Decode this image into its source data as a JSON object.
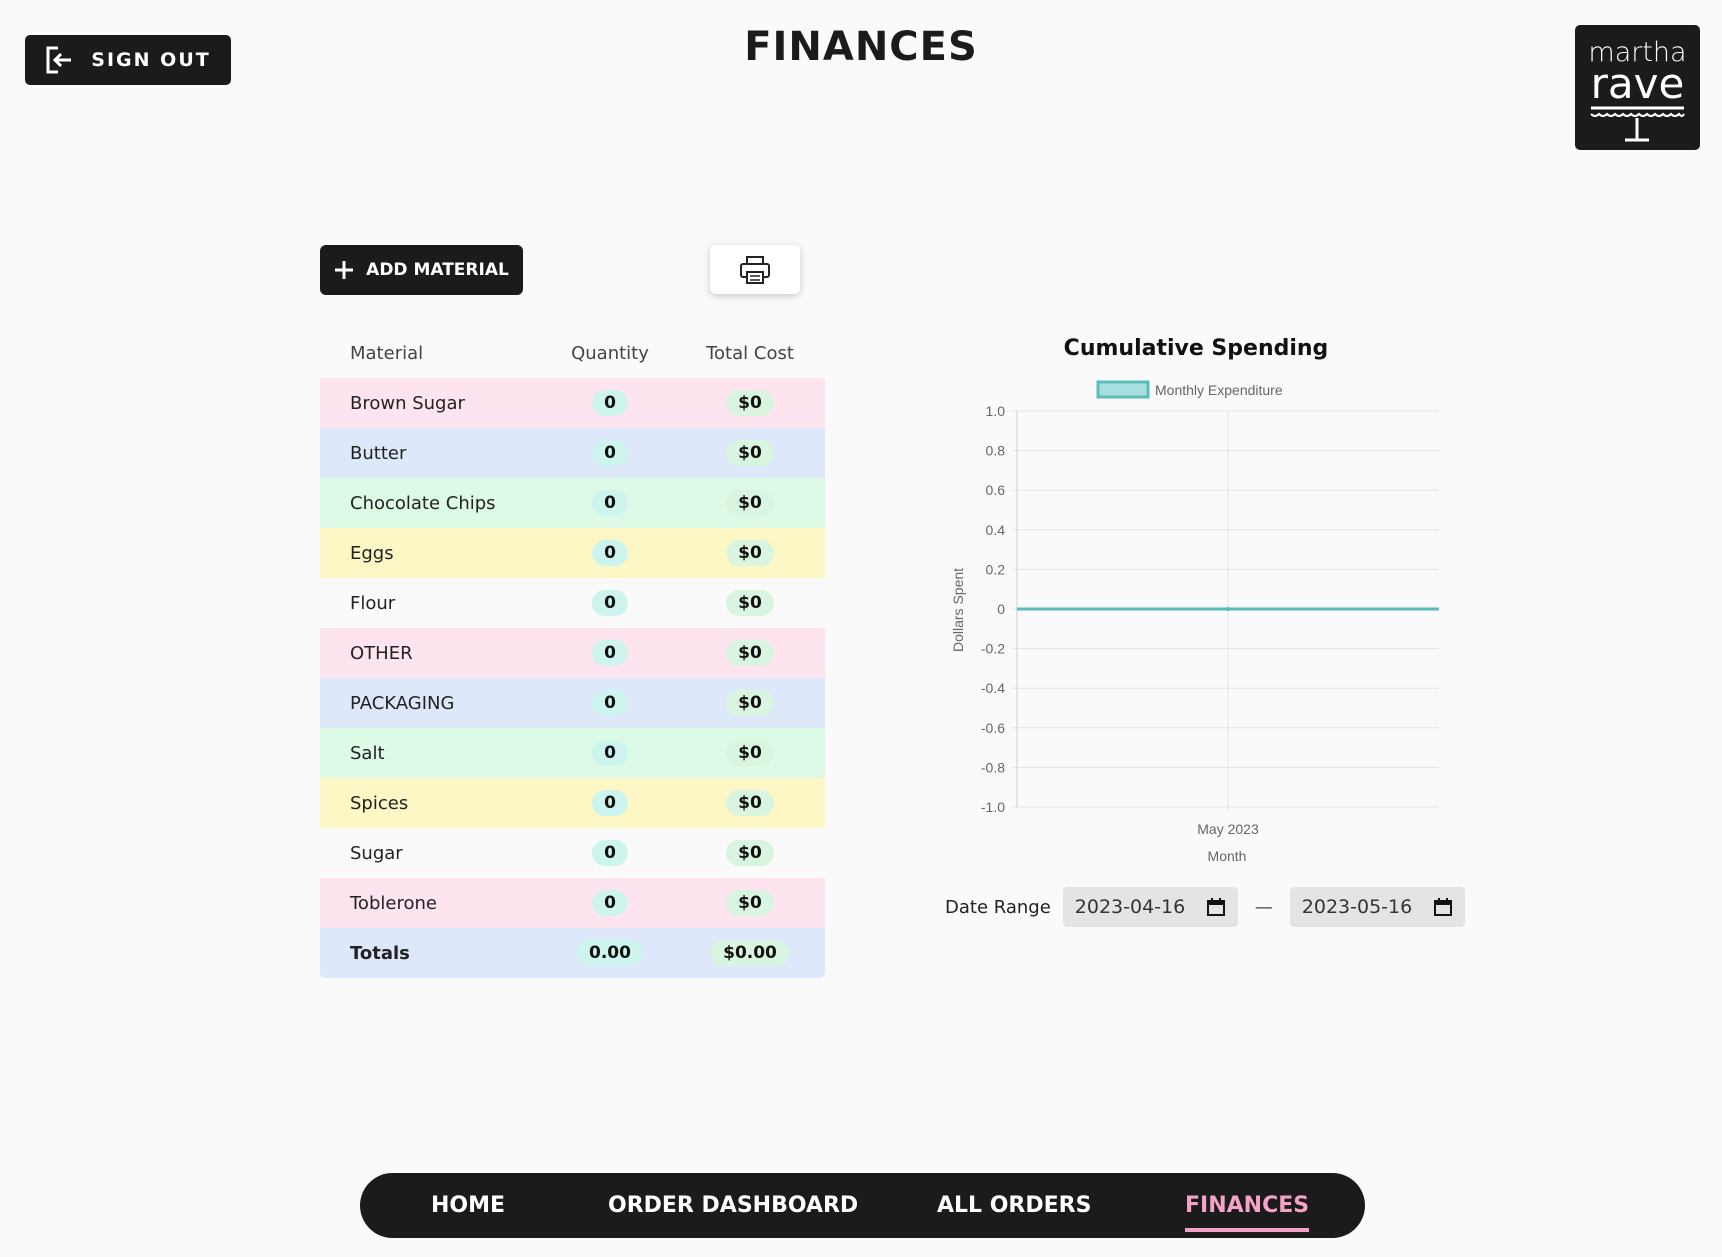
{
  "header": {
    "signout_label": "SIGN OUT",
    "title": "FINANCES",
    "logo_line1": "martha",
    "logo_line2": "rave"
  },
  "toolbar": {
    "add_label": "ADD MATERIAL"
  },
  "table": {
    "headers": [
      "Material",
      "Quantity",
      "Total Cost"
    ],
    "rows": [
      {
        "material": "Brown Sugar",
        "quantity": "0",
        "cost": "$0",
        "bg": "#fde4ef"
      },
      {
        "material": "Butter",
        "quantity": "0",
        "cost": "$0",
        "bg": "#dde9fb"
      },
      {
        "material": "Chocolate Chips",
        "quantity": "0",
        "cost": "$0",
        "bg": "#ddfae6"
      },
      {
        "material": "Eggs",
        "quantity": "0",
        "cost": "$0",
        "bg": "#fdf7c6"
      },
      {
        "material": "Flour",
        "quantity": "0",
        "cost": "$0",
        "bg": "#fafafa"
      },
      {
        "material": "OTHER",
        "quantity": "0",
        "cost": "$0",
        "bg": "#fde4ef"
      },
      {
        "material": "PACKAGING",
        "quantity": "0",
        "cost": "$0",
        "bg": "#dde9fb"
      },
      {
        "material": "Salt",
        "quantity": "0",
        "cost": "$0",
        "bg": "#ddfae6"
      },
      {
        "material": "Spices",
        "quantity": "0",
        "cost": "$0",
        "bg": "#fdf7c6"
      },
      {
        "material": "Sugar",
        "quantity": "0",
        "cost": "$0",
        "bg": "#fafafa"
      },
      {
        "material": "Toblerone",
        "quantity": "0",
        "cost": "$0",
        "bg": "#fde4ef"
      }
    ],
    "totals": {
      "label": "Totals",
      "quantity": "0.00",
      "cost": "$0.00",
      "bg": "#dde9fb"
    }
  },
  "chart_data": {
    "type": "line",
    "title": "Cumulative Spending",
    "legend": "Monthly Expenditure",
    "legend_placement": "top",
    "xlabel": "Month",
    "ylabel": "Dollars Spent",
    "categories": [
      "May 2023"
    ],
    "series": [
      {
        "name": "Monthly Expenditure",
        "values": [
          0
        ]
      }
    ],
    "ylim": [
      -1.0,
      1.0
    ],
    "yticks": [
      "1.0",
      "0.8",
      "0.6",
      "0.4",
      "0.2",
      "0",
      "-0.2",
      "-0.4",
      "-0.6",
      "-0.8",
      "-1.0"
    ],
    "grid": true,
    "line_color": "#5bbcbc",
    "fill_color": "#a8dede"
  },
  "date_range": {
    "label": "Date Range",
    "start": "2023-04-16",
    "end": "2023-05-16",
    "separator": "—"
  },
  "nav": {
    "items": [
      {
        "label": "HOME",
        "active": false
      },
      {
        "label": "ORDER DASHBOARD",
        "active": false
      },
      {
        "label": "ALL ORDERS",
        "active": false
      },
      {
        "label": "FINANCES",
        "active": true
      }
    ],
    "active_color": "#f4a3c8"
  }
}
